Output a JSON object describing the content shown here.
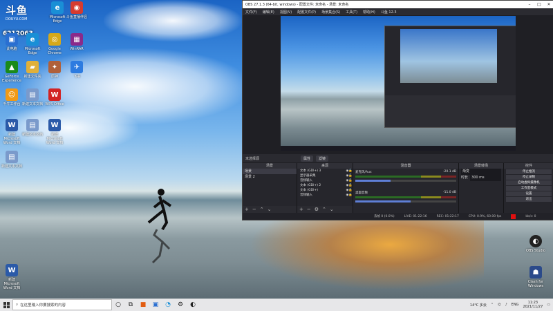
{
  "desktop": {
    "brand": {
      "logo": "斗鱼",
      "sub": "DOUYU.COM"
    },
    "room_number": "6212063",
    "icons": [
      {
        "label": "此电脑",
        "color": "#2a6fd1",
        "glyph": "▣"
      },
      {
        "label": "Microsoft Edge",
        "color": "#1a8fd6",
        "glyph": "e"
      },
      {
        "label": "腾讯会议",
        "color": "#d63b2f",
        "glyph": "◉"
      },
      {
        "label": "斗鱼直播伴侣",
        "color": "#e25d12",
        "glyph": "▶"
      },
      {
        "label": "回收站",
        "color": "#4a7fb5",
        "glyph": "🗑"
      },
      {
        "label": "Google Chrome",
        "color": "#d6a91a",
        "glyph": "◎"
      },
      {
        "label": "WinRAR",
        "color": "#8a2a8a",
        "glyph": "▦"
      },
      {
        "label": "GeForce Experience",
        "color": "#1a8a1a",
        "glyph": "▲"
      },
      {
        "label": "新建文件夹",
        "color": "#e0b03a",
        "glyph": "📁"
      },
      {
        "label": "原神",
        "color": "#b0603a",
        "glyph": "✦"
      },
      {
        "label": "飞书",
        "color": "#2d7be0",
        "glyph": "✈"
      },
      {
        "label": "千牛工作台",
        "color": "#f09a16",
        "glyph": "☺"
      },
      {
        "label": "新建文本文档",
        "color": "#7a9acb",
        "glyph": "▤"
      },
      {
        "label": "WPS Office",
        "color": "#d22424",
        "glyph": "W"
      },
      {
        "label": "新建 Microsoft Word 文档",
        "color": "#2b5aa8",
        "glyph": "W"
      },
      {
        "label": "新建文本文档",
        "color": "#7a9acb",
        "glyph": "▤"
      },
      {
        "label": "新建 Microsoft Word 文档",
        "color": "#2b5aa8",
        "glyph": "W"
      },
      {
        "label": "新建文本文档",
        "color": "#7a9acb",
        "glyph": "▤"
      },
      {
        "label": "新建 Microsoft Word 文档",
        "color": "#2b5aa8",
        "glyph": "W"
      },
      {
        "label": "OBS Studio",
        "color": "#222",
        "glyph": "◐"
      },
      {
        "label": "Clash for Windows",
        "color": "#2b4a8a",
        "glyph": "🐱"
      }
    ]
  },
  "obs": {
    "title": "OBS 27.1.3 (64-bit, windows) - 配置文件: 未命名 - 场景: 未命名",
    "menu": [
      "文件(F)",
      "编辑(E)",
      "视图(V)",
      "配置文件(P)",
      "场景集合(S)",
      "工具(T)",
      "帮助(H)",
      "斗鱼 12.3"
    ],
    "toolbar": {
      "no_source": "未选择源",
      "properties": "属性",
      "filters": "滤镜"
    },
    "scenes": {
      "header": "场景",
      "items": [
        "场景",
        "场景 2"
      ]
    },
    "sources": {
      "header": "来源",
      "items": [
        "文本 (GDI+) 3",
        "显示器采集",
        "音频输入",
        "文本 (GDI+) 2",
        "文本 (GDI+)",
        "音频输入"
      ]
    },
    "mixer": {
      "header": "混音器",
      "channels": [
        {
          "name": "麦克风/Aux",
          "db": "-20.1 dB",
          "level": 0.35
        },
        {
          "name": "桌面音频",
          "db": "-11.0 dB",
          "level": 0.55
        }
      ]
    },
    "transitions": {
      "header": "场景转场",
      "type": "渐变",
      "duration_label": "时长",
      "duration": "300 ms"
    },
    "controls": {
      "header": "控件",
      "buttons": [
        "停止推流",
        "停止录制",
        "启动虚拟摄像机",
        "工作室模式",
        "设置",
        "退出"
      ]
    },
    "status": {
      "dropped": "丢帧 0 (0.0%)",
      "live": "LIVE: 01:22:16",
      "rec": "REC: 01:22:17",
      "cpu": "CPU: 0.9%, 60.00 fps",
      "kbs": "kb/s: 0"
    }
  },
  "taskbar": {
    "search_placeholder": "在这里输入你要搜索的内容",
    "weather": "14°C 多云",
    "lang": "ENG",
    "time": "11:23",
    "date": "2021/11/27"
  }
}
